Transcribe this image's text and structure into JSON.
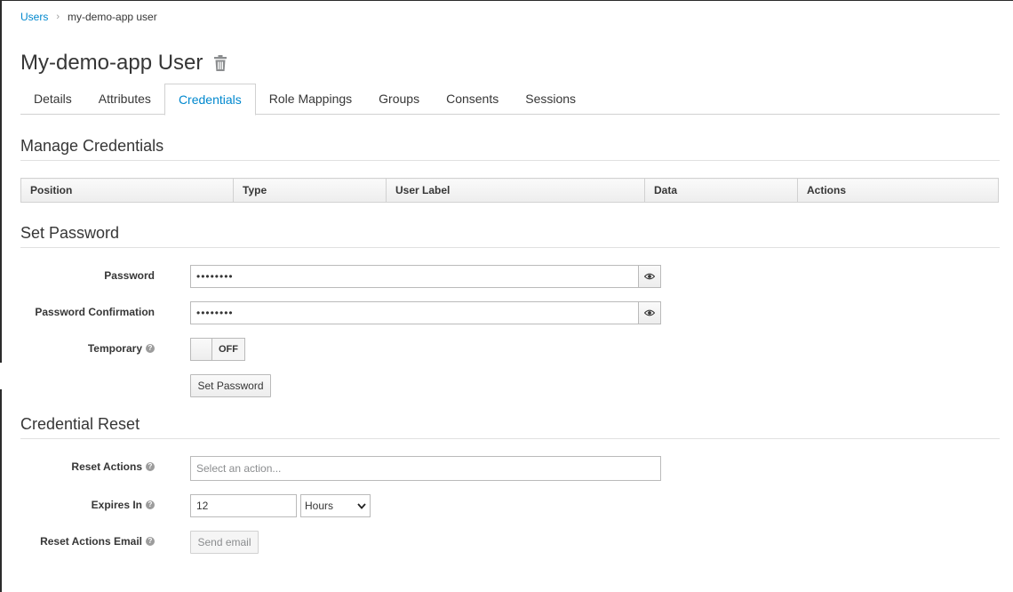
{
  "breadcrumb": {
    "parent": "Users",
    "separator": "›",
    "current": "my-demo-app user"
  },
  "page": {
    "title": "My-demo-app User",
    "delete_icon": "trash-icon"
  },
  "tabs": [
    {
      "label": "Details",
      "active": false
    },
    {
      "label": "Attributes",
      "active": false
    },
    {
      "label": "Credentials",
      "active": true
    },
    {
      "label": "Role Mappings",
      "active": false
    },
    {
      "label": "Groups",
      "active": false
    },
    {
      "label": "Consents",
      "active": false
    },
    {
      "label": "Sessions",
      "active": false
    }
  ],
  "manage_credentials": {
    "title": "Manage Credentials",
    "columns": [
      "Position",
      "Type",
      "User Label",
      "Data",
      "Actions"
    ]
  },
  "set_password": {
    "title": "Set Password",
    "password_label": "Password",
    "password_value": "••••••••",
    "confirmation_label": "Password Confirmation",
    "confirmation_value": "••••••••",
    "temporary_label": "Temporary",
    "temporary_state": "OFF",
    "submit_label": "Set Password",
    "help_glyph": "?"
  },
  "credential_reset": {
    "title": "Credential Reset",
    "reset_actions_label": "Reset Actions",
    "reset_actions_placeholder": "Select an action...",
    "expires_label": "Expires In",
    "expires_value": "12",
    "expires_unit": "Hours",
    "email_label": "Reset Actions Email",
    "send_email_label": "Send email"
  },
  "colors": {
    "link": "#0088ce",
    "text": "#363636",
    "border": "#bababa"
  }
}
